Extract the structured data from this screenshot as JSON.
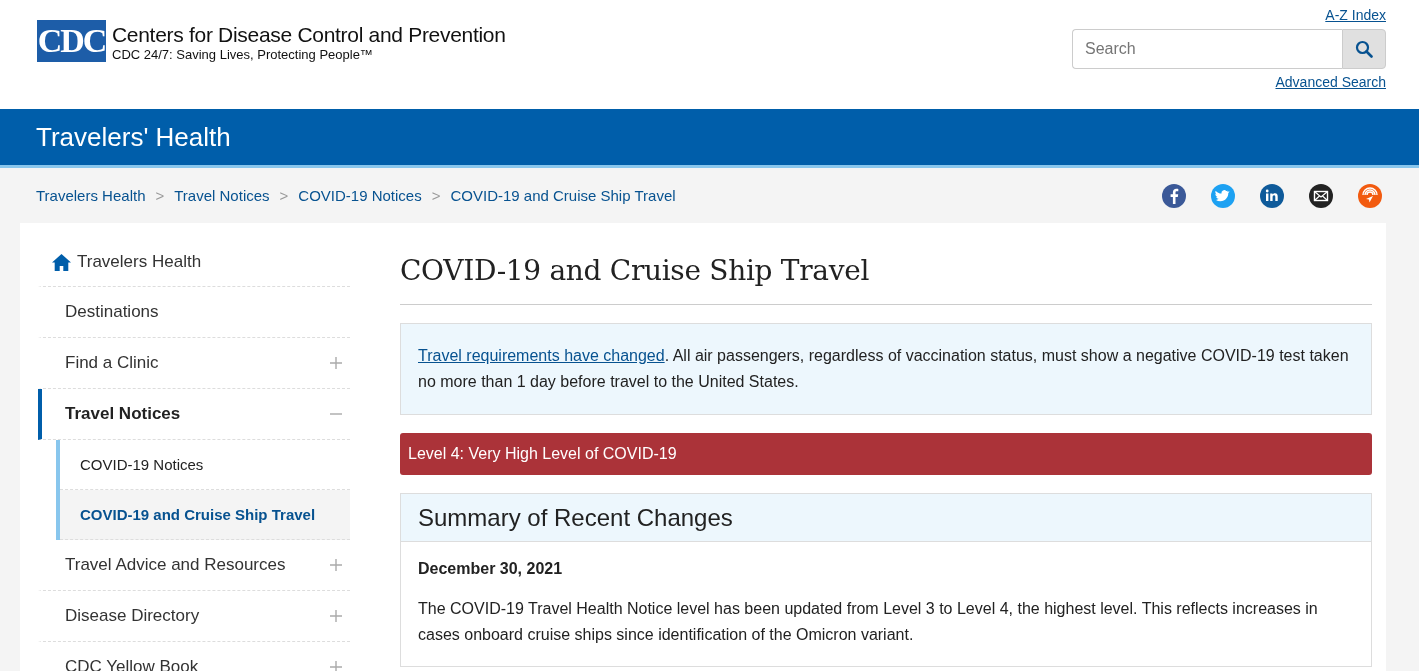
{
  "header": {
    "logo_text": "CDC",
    "org_name": "Centers for Disease Control and Prevention",
    "tagline": "CDC 24/7: Saving Lives, Protecting People™",
    "az_link": "A-Z Index",
    "search": {
      "placeholder": "Search"
    },
    "advanced_link": "Advanced Search"
  },
  "banner": {
    "title": "Travelers' Health"
  },
  "breadcrumb": [
    {
      "label": "Travelers Health"
    },
    {
      "label": "Travel Notices"
    },
    {
      "label": "COVID-19 Notices"
    },
    {
      "label": "COVID-19 and Cruise Ship Travel"
    }
  ],
  "breadcrumb_separator": ">",
  "share_icons": [
    {
      "kind": "facebook",
      "color": "#3b5998"
    },
    {
      "kind": "twitter",
      "color": "#1da1f2"
    },
    {
      "kind": "linkedin",
      "color": "#0e5a9a"
    },
    {
      "kind": "email",
      "color": "#222222"
    },
    {
      "kind": "syndicate",
      "color": "#f25a0f"
    }
  ],
  "sidebar": {
    "home": {
      "label": "Travelers Health"
    },
    "items": [
      {
        "label": "Destinations",
        "selected": false
      },
      {
        "label": "Find a Clinic",
        "selected": false,
        "expanded": false
      },
      {
        "label": "Travel Notices",
        "selected": true,
        "expanded": true,
        "children": [
          {
            "label": "COVID-19 Notices",
            "selected": false
          },
          {
            "label": "COVID-19 and Cruise Ship Travel",
            "selected": true
          }
        ]
      },
      {
        "label": "Travel Advice and Resources",
        "selected": false,
        "expanded": false
      },
      {
        "label": "Disease Directory",
        "selected": false,
        "expanded": false
      },
      {
        "label": "CDC Yellow Book",
        "selected": false,
        "expanded": false
      }
    ]
  },
  "main": {
    "title": "COVID-19 and Cruise Ship Travel",
    "alert": {
      "link": "Travel requirements have changed",
      "text": ". All air passengers, regardless of vaccination status, must show a negative COVID-19 test taken no more than 1 day before travel to the United States."
    },
    "level_bar": {
      "label": "Level 4: Very High Level of COVID-19",
      "color": "#ab3339"
    },
    "summary": {
      "title": "Summary of Recent Changes",
      "date": "December 30, 2021",
      "text": "The COVID-19 Travel Health Notice level has been updated from Level 3 to Level 4, the highest level. This reflects increases in cases onboard cruise ships since identification of the Omicron variant."
    }
  }
}
